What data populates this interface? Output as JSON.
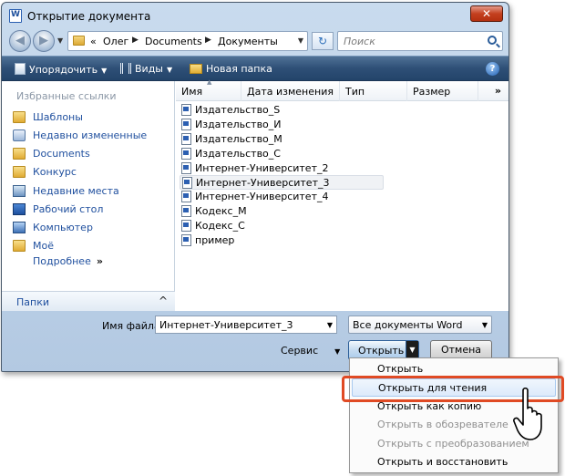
{
  "window": {
    "title": "Открытие документа",
    "close_label": "✕"
  },
  "address": {
    "crumbs": [
      "«",
      "Олег",
      "Documents",
      "Документы"
    ],
    "search_placeholder": "Поиск"
  },
  "toolbar": {
    "organize": "Упорядочить",
    "views": "Виды",
    "new_folder": "Новая папка",
    "help": "?"
  },
  "nav": {
    "header": "Избранные ссылки",
    "items": [
      {
        "label": "Шаблоны",
        "icon": "folder-icon"
      },
      {
        "label": "Недавно измененные",
        "icon": "recent-docs-icon"
      },
      {
        "label": "Documents",
        "icon": "folder-icon"
      },
      {
        "label": "Конкурс",
        "icon": "folder-icon"
      },
      {
        "label": "Недавние места",
        "icon": "recent-places-icon"
      },
      {
        "label": "Рабочий стол",
        "icon": "desktop-icon"
      },
      {
        "label": "Компьютер",
        "icon": "computer-icon"
      },
      {
        "label": "Моё",
        "icon": "folder-icon"
      }
    ],
    "more": "Подробнее",
    "more_chevron": "»",
    "folders": "Папки",
    "folders_chevron": "^"
  },
  "columns": [
    "Имя",
    "Дата изменения",
    "Тип",
    "Размер"
  ],
  "columns_more": "»",
  "files": [
    "Издательство_S",
    "Издательство_И",
    "Издательство_М",
    "Издательство_С",
    "Интернет-Университет_2",
    "Интернет-Университет_3",
    "Интернет-Университет_4",
    "Кодекс_М",
    "Кодекс_С",
    "пример"
  ],
  "selected_file_index": 5,
  "bottom": {
    "filename_label": "Имя файла:",
    "filename_value": "Интернет-Университет_3",
    "filetype_value": "Все документы Word",
    "tools": "Сервис",
    "open": "Открыть",
    "cancel": "Отмена"
  },
  "menu": {
    "items": [
      {
        "label": "Открыть",
        "disabled": false
      },
      {
        "label": "Открыть для чтения",
        "disabled": false,
        "hover": true
      },
      {
        "label": "Открыть как копию",
        "disabled": false
      },
      {
        "label": "Открыть в обозревателе",
        "disabled": true
      },
      {
        "label": "Открыть с преобразованием",
        "disabled": true
      },
      {
        "label": "Открыть и восстановить",
        "disabled": false
      }
    ]
  },
  "colors": {
    "highlight": "#e04a24",
    "link": "#1f4f9e",
    "toolbar": "#2e4f76"
  }
}
